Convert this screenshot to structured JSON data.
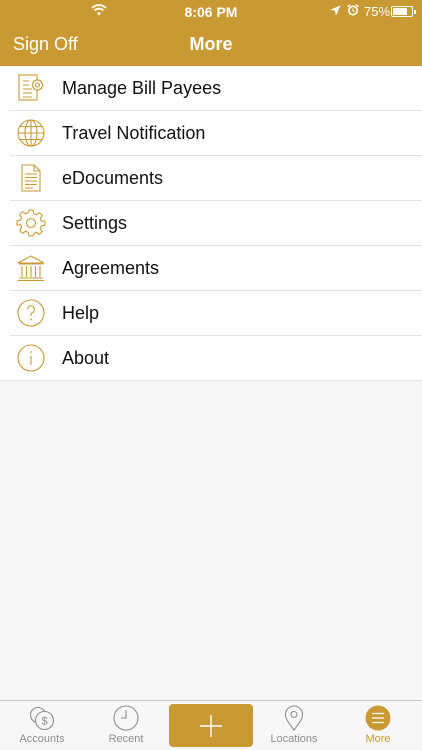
{
  "status_bar": {
    "time": "8:06 PM",
    "battery_percent": "75%",
    "battery_level": 0.75,
    "icons": [
      "wifi-icon",
      "location-arrow-icon",
      "alarm-icon",
      "battery-icon"
    ]
  },
  "nav": {
    "left_label": "Sign Off",
    "title": "More"
  },
  "menu": {
    "items": [
      {
        "label": "Manage Bill Payees",
        "icon": "bill-payee-document-gear-icon"
      },
      {
        "label": "Travel Notification",
        "icon": "globe-icon"
      },
      {
        "label": "eDocuments",
        "icon": "document-icon"
      },
      {
        "label": "Settings",
        "icon": "gear-icon"
      },
      {
        "label": "Agreements",
        "icon": "bank-building-icon"
      },
      {
        "label": "Help",
        "icon": "question-circle-icon"
      },
      {
        "label": "About",
        "icon": "info-circle-icon"
      }
    ]
  },
  "tabbar": {
    "tabs": [
      {
        "label": "Accounts",
        "icon": "accounts-coins-icon",
        "active": false
      },
      {
        "label": "Recent",
        "icon": "clock-icon",
        "active": false
      },
      {
        "label": "",
        "icon": "plus-icon",
        "active": false
      },
      {
        "label": "Locations",
        "icon": "map-pin-icon",
        "active": false
      },
      {
        "label": "More",
        "icon": "menu-lines-icon",
        "active": true
      }
    ]
  },
  "colors": {
    "accent": "#c99a34",
    "background": "#f7f7f7",
    "inactive_tab": "#8e8e8e"
  }
}
